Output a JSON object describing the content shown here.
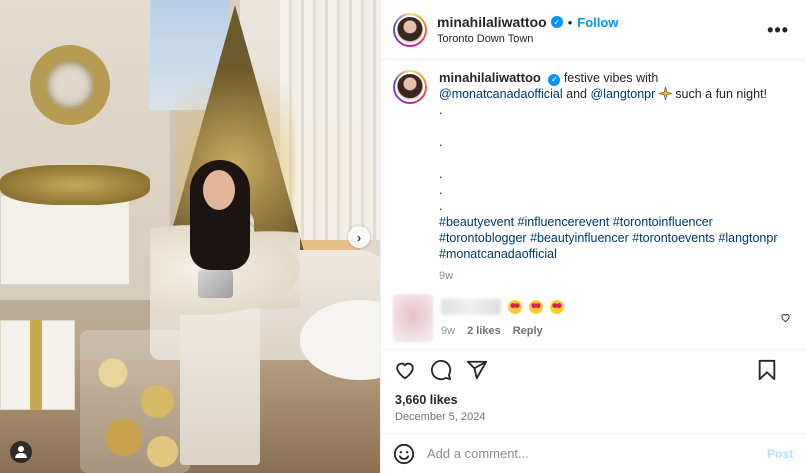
{
  "header": {
    "username": "minahilaliwattoo",
    "separator": "•",
    "follow_label": "Follow",
    "location": "Toronto Down Town",
    "more_label": "•••"
  },
  "caption": {
    "username": "minahilaliwattoo",
    "text_1": " festive vibes with ",
    "mention_1": "@monatcanadaofficial",
    "text_2": " and ",
    "mention_2": "@langtonpr",
    "text_3": " such a fun night!",
    "dots": [
      "."
    ],
    "hashtags": [
      "#beautyevent",
      "#influencerevent",
      "#torontoinfluencer",
      "#torontoblogger",
      "#beautyinfluencer",
      "#torontoevents",
      "#langtonpr",
      "#monatcanadaofficial"
    ],
    "time": "9w"
  },
  "comment": {
    "time": "9w",
    "likes": "2 likes",
    "reply": "Reply"
  },
  "stats": {
    "likes": "3,660 likes",
    "date": "December 5, 2024"
  },
  "composer": {
    "placeholder": "Add a comment...",
    "post_label": "Post"
  },
  "icons": {
    "verified": "verified-badge-icon",
    "like": "heart-icon",
    "comment": "comment-bubble-icon",
    "share": "paper-plane-icon",
    "save": "bookmark-icon",
    "emoji": "smiley-icon",
    "next": "chevron-right-icon",
    "tags": "user-tag-icon"
  },
  "colors": {
    "accent": "#0095f6",
    "link": "#00376b",
    "muted": "#8e8e8e",
    "post_disabled": "#b2dffc"
  }
}
